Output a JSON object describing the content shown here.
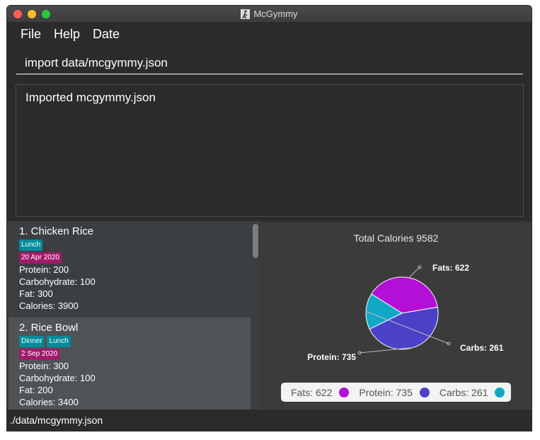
{
  "window": {
    "title": "McGymmy"
  },
  "menu": {
    "file": "File",
    "help": "Help",
    "date": "Date"
  },
  "command": {
    "value": "import data/mcgymmy.json"
  },
  "result": {
    "text": "Imported mcgymmy.json"
  },
  "foods": [
    {
      "title": "1.  Chicken Rice",
      "tags": [
        "Lunch"
      ],
      "date": "20 Apr 2020",
      "protein": "Protein: 200",
      "carbs": "Carbohydrate: 100",
      "fat": "Fat: 300",
      "calories": "Calories: 3900"
    },
    {
      "title": "2.  Rice Bowl",
      "tags": [
        "Dinner",
        "Lunch"
      ],
      "date": "2 Sep 2020",
      "protein": "Protein: 300",
      "carbs": "Carbohydrate: 100",
      "fat": "Fat: 200",
      "calories": "Calories: 3400"
    }
  ],
  "chart_data": {
    "type": "pie",
    "title": "Total Calories 9582",
    "slices": [
      {
        "label": "Fats",
        "value": 622,
        "color": "#b40fd6",
        "callout": "Fats: 622"
      },
      {
        "label": "Protein",
        "value": 735,
        "color": "#4b40c8",
        "callout": "Protein: 735"
      },
      {
        "label": "Carbs",
        "value": 261,
        "color": "#11a7c6",
        "callout": "Carbs: 261"
      }
    ],
    "legend": [
      "Fats: 622",
      "Protein: 735",
      "Carbs: 261"
    ],
    "legend_placement": "bottom"
  },
  "status": {
    "path": "./data/mcgymmy.json"
  },
  "colors": {
    "tag_meal": "#008b9b",
    "tag_date": "#a11b6c",
    "fats": "#b40fd6",
    "protein": "#4b40c8",
    "carbs": "#11a7c6"
  }
}
